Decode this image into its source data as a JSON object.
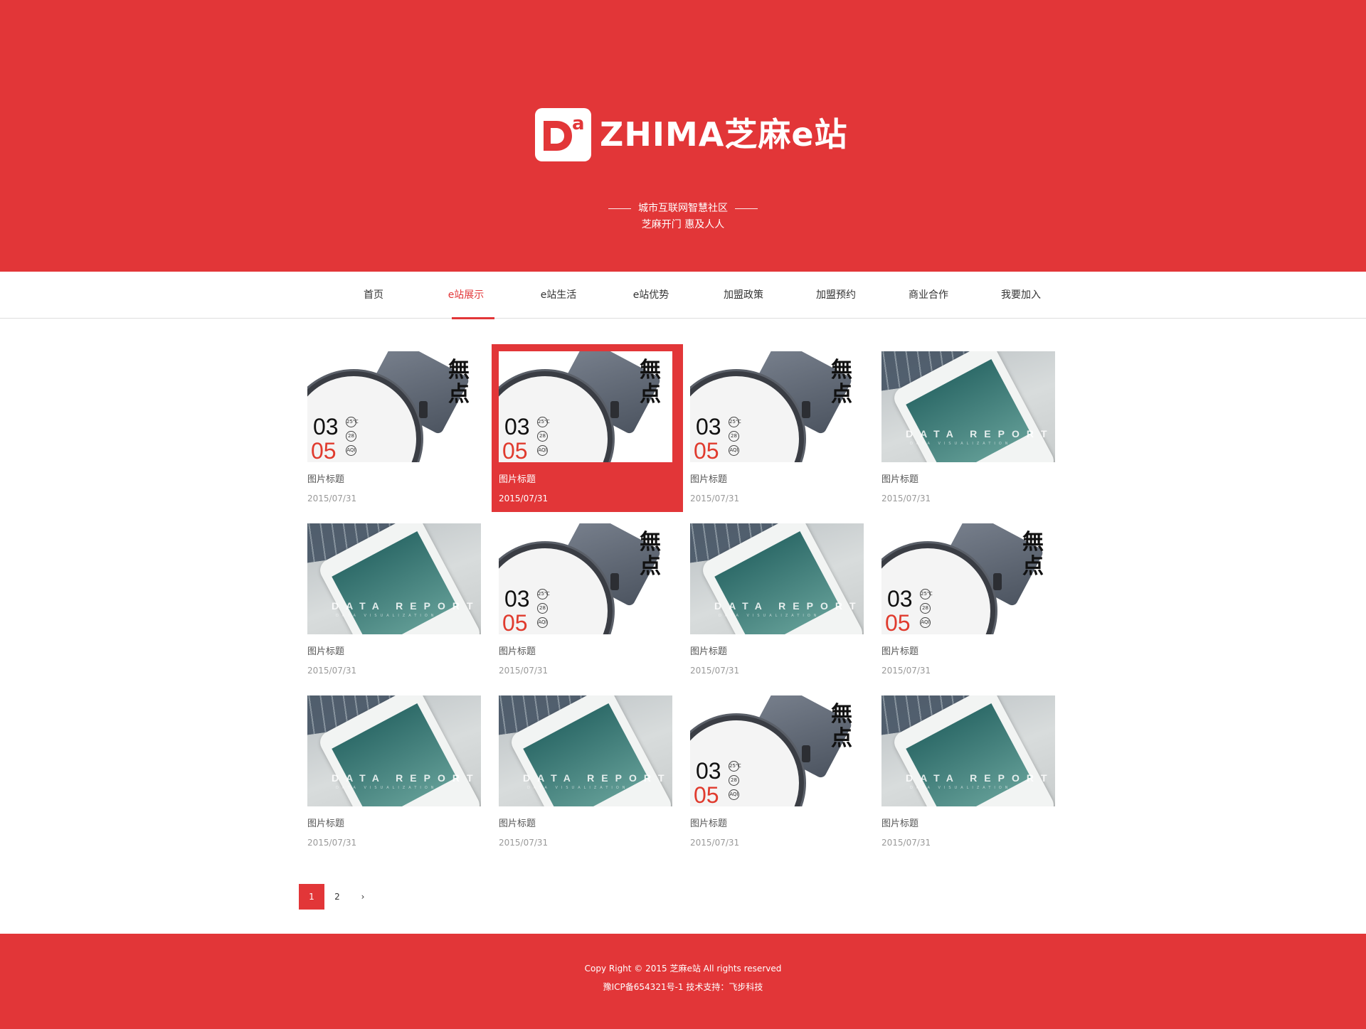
{
  "brand": {
    "logo_mark": "Da",
    "logo_text": "ZHIMA芝麻e站",
    "slogan_1": "城市互联网智慧社区",
    "slogan_2": "芝麻开门  惠及人人",
    "accent_color": "#e23638"
  },
  "nav": {
    "items": [
      {
        "label": "首页",
        "active": false
      },
      {
        "label": "e站展示",
        "active": true
      },
      {
        "label": "e站生活",
        "active": false
      },
      {
        "label": "e站优势",
        "active": false
      },
      {
        "label": "加盟政策",
        "active": false
      },
      {
        "label": "加盟预约",
        "active": false
      },
      {
        "label": "商业合作",
        "active": false
      },
      {
        "label": "我要加入",
        "active": false
      }
    ]
  },
  "gallery": {
    "thumb_watch": {
      "n1": "03",
      "n2": "05",
      "zh1": "無",
      "zh2": "点",
      "dot1": "25℃",
      "dot2": "28",
      "dot3": "AQI"
    },
    "thumb_phone": {
      "text": "DATA REPORT",
      "sub": "DATA VISUALIZATION"
    },
    "items": [
      {
        "type": "watch",
        "title": "图片标题",
        "date": "2015/07/31",
        "highlighted": false
      },
      {
        "type": "watch",
        "title": "图片标题",
        "date": "2015/07/31",
        "highlighted": true
      },
      {
        "type": "watch",
        "title": "图片标题",
        "date": "2015/07/31",
        "highlighted": false
      },
      {
        "type": "phone",
        "title": "图片标题",
        "date": "2015/07/31",
        "highlighted": false
      },
      {
        "type": "phone",
        "title": "图片标题",
        "date": "2015/07/31",
        "highlighted": false
      },
      {
        "type": "watch",
        "title": "图片标题",
        "date": "2015/07/31",
        "highlighted": false
      },
      {
        "type": "phone",
        "title": "图片标题",
        "date": "2015/07/31",
        "highlighted": false
      },
      {
        "type": "watch",
        "title": "图片标题",
        "date": "2015/07/31",
        "highlighted": false
      },
      {
        "type": "phone",
        "title": "图片标题",
        "date": "2015/07/31",
        "highlighted": false
      },
      {
        "type": "phone",
        "title": "图片标题",
        "date": "2015/07/31",
        "highlighted": false
      },
      {
        "type": "watch",
        "title": "图片标题",
        "date": "2015/07/31",
        "highlighted": false
      },
      {
        "type": "phone",
        "title": "图片标题",
        "date": "2015/07/31",
        "highlighted": false
      }
    ]
  },
  "pagination": {
    "pages": [
      "1",
      "2"
    ],
    "current": "1",
    "next_icon": "chevron-right-icon",
    "next_label": "›"
  },
  "footer": {
    "copyright": "Copy Right © 2015 芝麻e站 All rights reserved",
    "icp": "豫ICP备654321号-1 技术支持：飞步科技"
  }
}
